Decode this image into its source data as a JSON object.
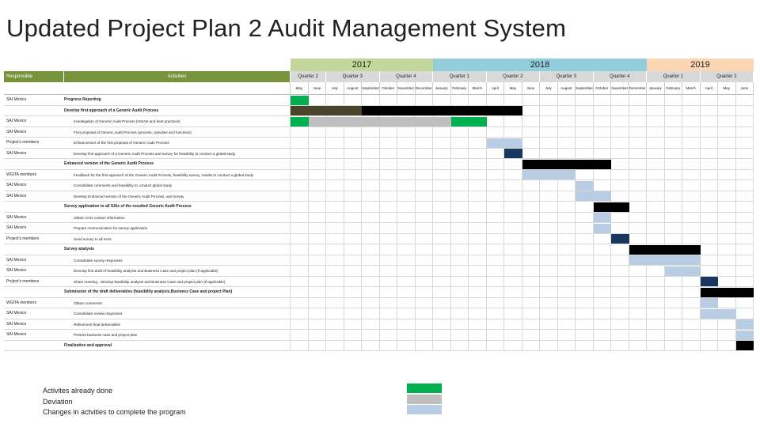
{
  "title": "Updated Project Plan 2 Audit Management System",
  "colors": {
    "green": "#00b050",
    "gray": "#bfbfbf",
    "lightblue": "#b8cce4",
    "black": "#000000",
    "navy": "#17375e",
    "olive": "#4a452a",
    "y2017": "#c4d79b",
    "y2018": "#92cddc",
    "y2019": "#fcd5b4",
    "header": "#77933c"
  },
  "header": {
    "responsible": "Responsible",
    "activities": "Activities"
  },
  "years": [
    {
      "label": "2017",
      "color": "#c4d79b",
      "months": 8
    },
    {
      "label": "2018",
      "color": "#92cddc",
      "months": 12
    },
    {
      "label": "2019",
      "color": "#fcd5b4",
      "months": 6
    }
  ],
  "quarters": [
    {
      "label": "Quarter 2",
      "months": 2
    },
    {
      "label": "Quarter 3",
      "months": 3
    },
    {
      "label": "Quarter 4",
      "months": 3
    },
    {
      "label": "Quarter 1",
      "months": 3
    },
    {
      "label": "Quarter 2",
      "months": 3
    },
    {
      "label": "Quarter 3",
      "months": 3
    },
    {
      "label": "Quarter 4",
      "months": 3
    },
    {
      "label": "Quarter 1",
      "months": 3
    },
    {
      "label": "Quarter 2",
      "months": 3
    }
  ],
  "months": [
    "May",
    "June",
    "July",
    "August",
    "September",
    "October",
    "November",
    "December",
    "January",
    "February",
    "March",
    "April",
    "May",
    "June",
    "July",
    "August",
    "September",
    "October",
    "November",
    "December",
    "January",
    "February",
    "March",
    "April",
    "May",
    "June"
  ],
  "rows": [
    {
      "responsible": "SAI Mexico",
      "activity": "Progress Reporting",
      "bold": true,
      "bars": [
        {
          "s": 0,
          "e": 1,
          "c": "green"
        }
      ]
    },
    {
      "responsible": "",
      "activity": "Develop first approach of a Generic Audit Process",
      "bold": true,
      "bars": [
        {
          "s": 0,
          "e": 4,
          "c": "olive"
        },
        {
          "s": 4,
          "e": 13,
          "c": "black"
        }
      ]
    },
    {
      "responsible": "SAI Mexico",
      "activity": "Investigation of Generic Audit Process (ISSAIs and best practices)",
      "bold": false,
      "bars": [
        {
          "s": 0,
          "e": 1,
          "c": "green"
        },
        {
          "s": 1,
          "e": 9,
          "c": "gray"
        },
        {
          "s": 9,
          "e": 11,
          "c": "green"
        }
      ]
    },
    {
      "responsible": "SAI Mexico",
      "activity": "First proposal of Generic Audit Process (process, activities and functions)",
      "bold": false,
      "bars": []
    },
    {
      "responsible": "Project's members",
      "activity": "Enhancement of the first proposal of Generic Audit Process",
      "bold": false,
      "bars": [
        {
          "s": 11,
          "e": 13,
          "c": "lightblue"
        }
      ]
    },
    {
      "responsible": "SAI Mexico",
      "activity": "Develop first approach of a Generic Audit Process and survey for feasibility to conduct a global study",
      "bold": false,
      "bars": [
        {
          "s": 12,
          "e": 13,
          "c": "navy"
        }
      ]
    },
    {
      "responsible": "",
      "activity": "Enhanced version of the Generic Audit Process",
      "bold": true,
      "bars": [
        {
          "s": 13,
          "e": 18,
          "c": "black"
        }
      ]
    },
    {
      "responsible": "WGITA members",
      "activity": "Feedback for the first approach of the Generic Audit Process, feasibility survey, results to conduct a global study",
      "bold": false,
      "bars": [
        {
          "s": 13,
          "e": 16,
          "c": "lightblue"
        }
      ]
    },
    {
      "responsible": "SAI Mexico",
      "activity": "Consolidate comments and feasibility to conduct global study",
      "bold": false,
      "bars": [
        {
          "s": 16,
          "e": 17,
          "c": "lightblue"
        }
      ]
    },
    {
      "responsible": "SAI Mexico",
      "activity": "Develop Enhanced version of the Generic Audit Process, and survey",
      "bold": false,
      "bars": [
        {
          "s": 16,
          "e": 18,
          "c": "lightblue"
        }
      ]
    },
    {
      "responsible": "",
      "activity": "Survey application to all SAIs of the resulted Generic Audit Process",
      "bold": true,
      "bars": [
        {
          "s": 17,
          "e": 19,
          "c": "black"
        }
      ]
    },
    {
      "responsible": "SAI Mexico",
      "activity": "Obtain SAIs contact information",
      "bold": false,
      "bars": [
        {
          "s": 17,
          "e": 18,
          "c": "lightblue"
        }
      ]
    },
    {
      "responsible": "SAI Mexico",
      "activity": "Prepare communication for survey application",
      "bold": false,
      "bars": [
        {
          "s": 17,
          "e": 18,
          "c": "lightblue"
        }
      ]
    },
    {
      "responsible": "Project's members",
      "activity": "Send survey to all SAIs",
      "bold": false,
      "bars": [
        {
          "s": 18,
          "e": 19,
          "c": "navy"
        }
      ]
    },
    {
      "responsible": "",
      "activity": "Survey analysis",
      "bold": true,
      "bars": [
        {
          "s": 19,
          "e": 23,
          "c": "black"
        }
      ]
    },
    {
      "responsible": "SAI Mexico",
      "activity": "Consolidate survey responses",
      "bold": false,
      "bars": [
        {
          "s": 19,
          "e": 23,
          "c": "lightblue"
        }
      ]
    },
    {
      "responsible": "SAI Mexico",
      "activity": "Develop first draft of feasibility analysis and Business Case and project plan (if applicable)",
      "bold": false,
      "bars": [
        {
          "s": 21,
          "e": 23,
          "c": "lightblue"
        }
      ]
    },
    {
      "responsible": "Project's members",
      "activity": "Share meeting - develop feasibility analysis and Business Case and project plan (if applicable)",
      "bold": false,
      "bars": [
        {
          "s": 23,
          "e": 24,
          "c": "navy"
        }
      ]
    },
    {
      "responsible": "",
      "activity": "Submission of the draft deliverables (feasibility analysis,Business Case and project Plan)",
      "bold": true,
      "bars": [
        {
          "s": 23,
          "e": 26,
          "c": "black"
        }
      ]
    },
    {
      "responsible": "WGITA members",
      "activity": "Obtain comments",
      "bold": false,
      "bars": [
        {
          "s": 23,
          "e": 24,
          "c": "lightblue"
        }
      ]
    },
    {
      "responsible": "SAI Mexico",
      "activity": "Consolidate review responses",
      "bold": false,
      "bars": [
        {
          "s": 23,
          "e": 25,
          "c": "lightblue"
        }
      ]
    },
    {
      "responsible": "SAI Mexico",
      "activity": "Refinement final deliverables",
      "bold": false,
      "bars": [
        {
          "s": 25,
          "e": 26,
          "c": "lightblue"
        }
      ]
    },
    {
      "responsible": "SAI Mexico",
      "activity": "Present business case and project plan",
      "bold": false,
      "bars": [
        {
          "s": 25,
          "e": 26,
          "c": "lightblue"
        }
      ]
    },
    {
      "responsible": "",
      "activity": "Finalization and approval",
      "bold": true,
      "bars": [
        {
          "s": 25,
          "e": 26,
          "c": "black"
        }
      ]
    }
  ],
  "legend": [
    {
      "label": "Activites already done",
      "color": "green"
    },
    {
      "label": "Deviation",
      "color": "gray"
    },
    {
      "label": "Changes in actvities to complete the program",
      "color": "lightblue"
    }
  ]
}
